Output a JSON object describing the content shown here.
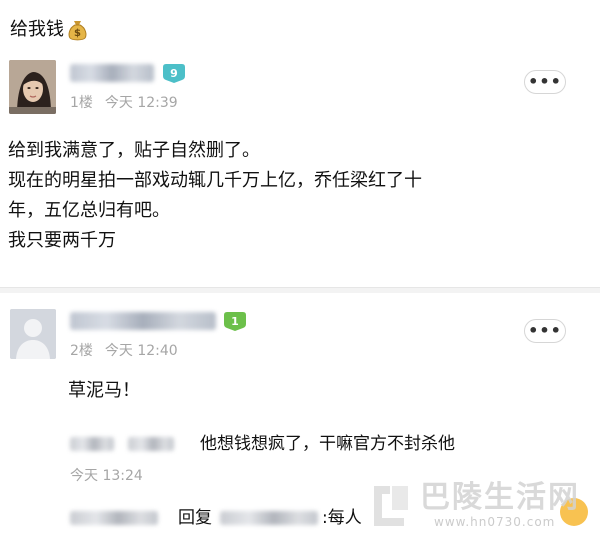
{
  "thread": {
    "title": "给我钱",
    "title_icon": "money-bag-icon"
  },
  "posts": [
    {
      "floor": "1楼",
      "time": "今天 12:39",
      "level": "9",
      "level_color": "#4cbfc8",
      "more": "•••",
      "lines": [
        "给到我满意了，贴子自然删了。",
        "现在的明星拍一部戏动辄几千万上亿，乔任梁红了十",
        "年，五亿总归有吧。",
        "我只要两千万"
      ]
    },
    {
      "floor": "2楼",
      "time": "今天 12:40",
      "level": "1",
      "level_color": "#6cc04a",
      "more": "•••",
      "text": "草泥马！",
      "sub_replies": [
        {
          "text": "他想钱想疯了，干嘛官方不封杀他",
          "time": "今天 13:24"
        },
        {
          "prefix": "回复",
          "text": ":每人"
        }
      ]
    }
  ],
  "watermark": {
    "title": "巴陵生活网",
    "url": "www.hn0730.com",
    "logo": "watermark-logo-icon"
  },
  "colors": {
    "meta_gray": "#a6a6a6",
    "background": "#f3f3f3"
  }
}
